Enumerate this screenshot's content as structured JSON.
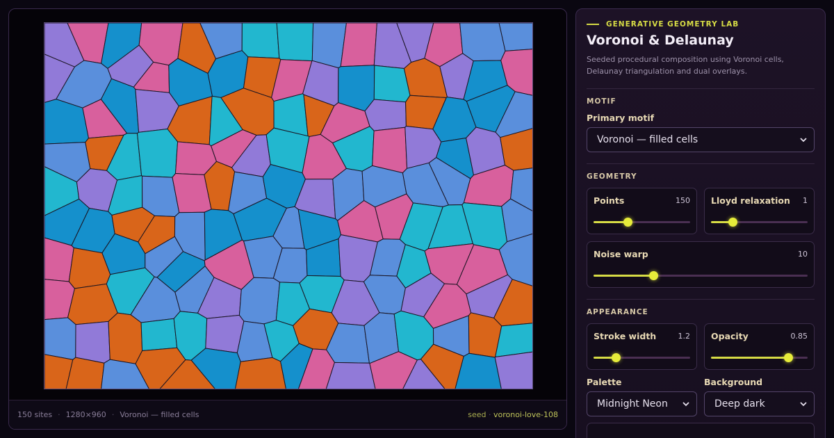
{
  "stage": {
    "footer": {
      "sites": "150 sites",
      "resolution": "1280×960",
      "motif": "Voronoi — filled cells",
      "seed_label": "seed",
      "seed_value": "voronoi-love-108"
    }
  },
  "panel": {
    "eyebrow": "GENERATIVE GEOMETRY LAB",
    "title": "Voronoi & Delaunay",
    "subtitle": "Seeded procedural composition using Voronoi cells, Delaunay triangulation and dual overlays.",
    "motif_section": "MOTIF",
    "primary_motif_label": "Primary motif",
    "primary_motif_value": "Voronoi — filled cells",
    "geometry_section": "GEOMETRY",
    "points": {
      "label": "Points",
      "value": "150",
      "fraction": 0.35
    },
    "lloyd": {
      "label": "Lloyd relaxation",
      "value": "1",
      "fraction": 0.22
    },
    "noise": {
      "label": "Noise warp",
      "value": "10",
      "fraction": 0.28
    },
    "appearance_section": "APPEARANCE",
    "stroke": {
      "label": "Stroke width",
      "value": "1.2",
      "fraction": 0.23
    },
    "opacity": {
      "label": "Opacity",
      "value": "0.85",
      "fraction": 0.8
    },
    "palette_label": "Palette",
    "palette_value": "Midnight Neon",
    "background_label": "Background",
    "background_value": "Deep dark"
  },
  "colors": {
    "accent": "#d7dc45",
    "palette": [
      "#5a8fdc",
      "#d8609d",
      "#d9651a",
      "#22b7cf",
      "#917ad8",
      "#1590cc"
    ]
  },
  "icons": [
    "chevron-down-icon"
  ]
}
